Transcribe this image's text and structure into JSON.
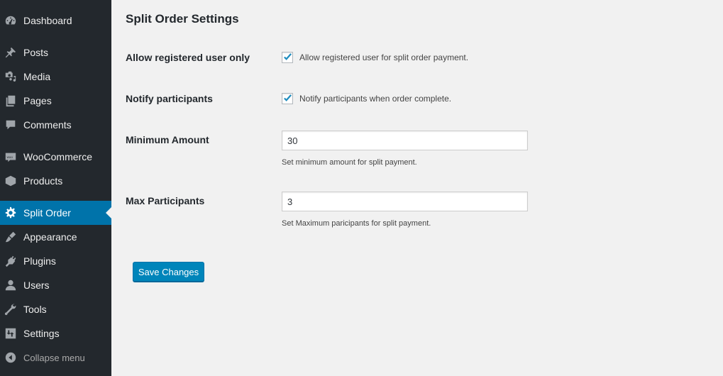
{
  "sidebar": {
    "items": [
      {
        "label": "Dashboard",
        "icon": "dashboard-icon"
      },
      {
        "label": "Posts",
        "icon": "pin-icon"
      },
      {
        "label": "Media",
        "icon": "media-icon"
      },
      {
        "label": "Pages",
        "icon": "pages-icon"
      },
      {
        "label": "Comments",
        "icon": "comment-icon"
      },
      {
        "label": "WooCommerce",
        "icon": "woo-icon"
      },
      {
        "label": "Products",
        "icon": "box-icon"
      },
      {
        "label": "Split Order",
        "icon": "gear-icon",
        "active": true
      },
      {
        "label": "Appearance",
        "icon": "brush-icon"
      },
      {
        "label": "Plugins",
        "icon": "plug-icon"
      },
      {
        "label": "Users",
        "icon": "user-icon"
      },
      {
        "label": "Tools",
        "icon": "wrench-icon"
      },
      {
        "label": "Settings",
        "icon": "sliders-icon"
      },
      {
        "label": "Collapse menu",
        "icon": "collapse-icon"
      }
    ],
    "accent": "#0073aa"
  },
  "page": {
    "title": "Split Order Settings",
    "fields": {
      "registered_only": {
        "label": "Allow registered user only",
        "checkbox_label": "Allow registered user for split order payment.",
        "checked": true
      },
      "notify": {
        "label": "Notify participants",
        "checkbox_label": "Notify participants when order complete.",
        "checked": true
      },
      "min_amount": {
        "label": "Minimum Amount",
        "value": "30",
        "description": "Set minimum amount for split payment."
      },
      "max_participants": {
        "label": "Max Participants",
        "value": "3",
        "description": "Set Maximum paricipants for split payment."
      }
    },
    "save_label": "Save Changes"
  }
}
